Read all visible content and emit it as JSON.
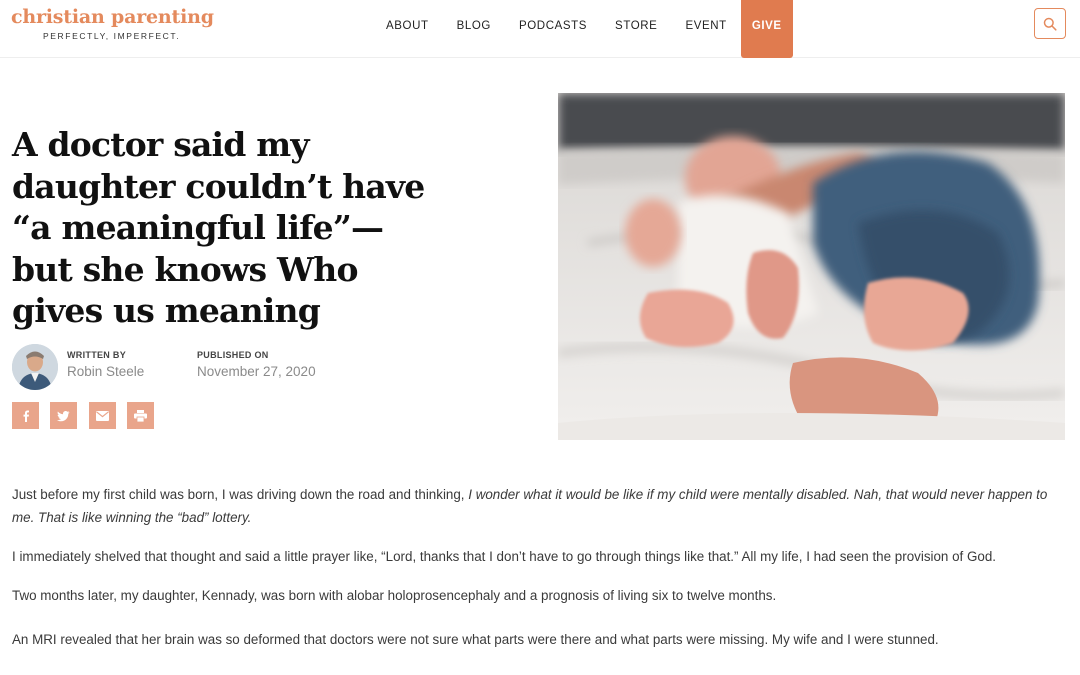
{
  "header": {
    "logo_title": "christian parenting",
    "logo_tagline": "PERFECTLY, IMPERFECT.",
    "nav": [
      "ABOUT",
      "BLOG",
      "PODCASTS",
      "STORE",
      "EVENT",
      "GIVE"
    ],
    "search_icon": "search-icon"
  },
  "article": {
    "title": "A doctor said my daughter couldn’t have “a meaningful life”—but she knows Who gives us meaning",
    "written_by_label": "WRITTEN BY",
    "author": "Robin Steele",
    "published_label": "PUBLISHED ON",
    "date": "November 27, 2020",
    "share_icons": [
      "facebook-icon",
      "twitter-icon",
      "email-icon",
      "print-icon"
    ],
    "p1_plain": "Just before my first child was born, I was driving down the road and thinking, ",
    "p1_italic": "I wonder what it would be like if my child were mentally disabled. Nah, that would never happen to me. That is like winning the “bad” lottery.",
    "p2": "I immediately shelved that thought and said a little prayer like, “Lord, thanks that I don’t have to go through things like that.” All my life, I had seen the provision of God.",
    "p3": "Two months later, my daughter, Kennady, was born with alobar holoprosencephaly and a prognosis of living six to twelve months.",
    "p4": "An MRI revealed that her brain was so deformed that doctors were not sure what parts were there and what parts were missing. My wife and I were stunned."
  },
  "colors": {
    "brand": "#e48a5d",
    "give_bg": "#e07b4f",
    "share_bg": "#e9a58b"
  }
}
